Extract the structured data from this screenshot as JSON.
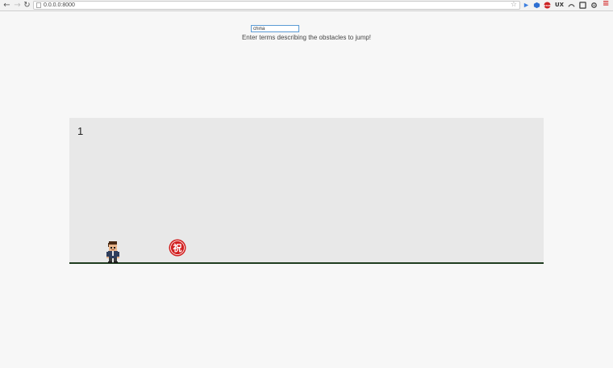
{
  "browser": {
    "url": "0.0.0.0:8000",
    "back_icon": "←",
    "forward_icon": "→",
    "reload_icon": "↻",
    "star_icon": "☆",
    "extensions": [
      {
        "name": "lightbulb-extension-icon",
        "color": "#3d7fe0"
      },
      {
        "name": "cube-extension-icon",
        "color": "#2d6fd2"
      },
      {
        "name": "stop-extension-icon",
        "color": "#cc2222"
      },
      {
        "name": "ux-check-extension-icon",
        "color": "#333333"
      },
      {
        "name": "arc-extension-icon",
        "color": "#555555"
      },
      {
        "name": "window-extension-icon",
        "color": "#555555"
      },
      {
        "name": "gear-extension-icon",
        "color": "#444444"
      },
      {
        "name": "menu-icon",
        "color": "#d63030"
      }
    ],
    "stop_badge": "STOP",
    "ux_label": "UX",
    "menu_glyph": "≡"
  },
  "game": {
    "search_value": "china",
    "instructions": "Enter terms describing the obstacles to jump!",
    "score": "1",
    "obstacle_glyph": "祝",
    "ground_color": "#1f3d1f",
    "obstacle_color": "#d22020"
  }
}
